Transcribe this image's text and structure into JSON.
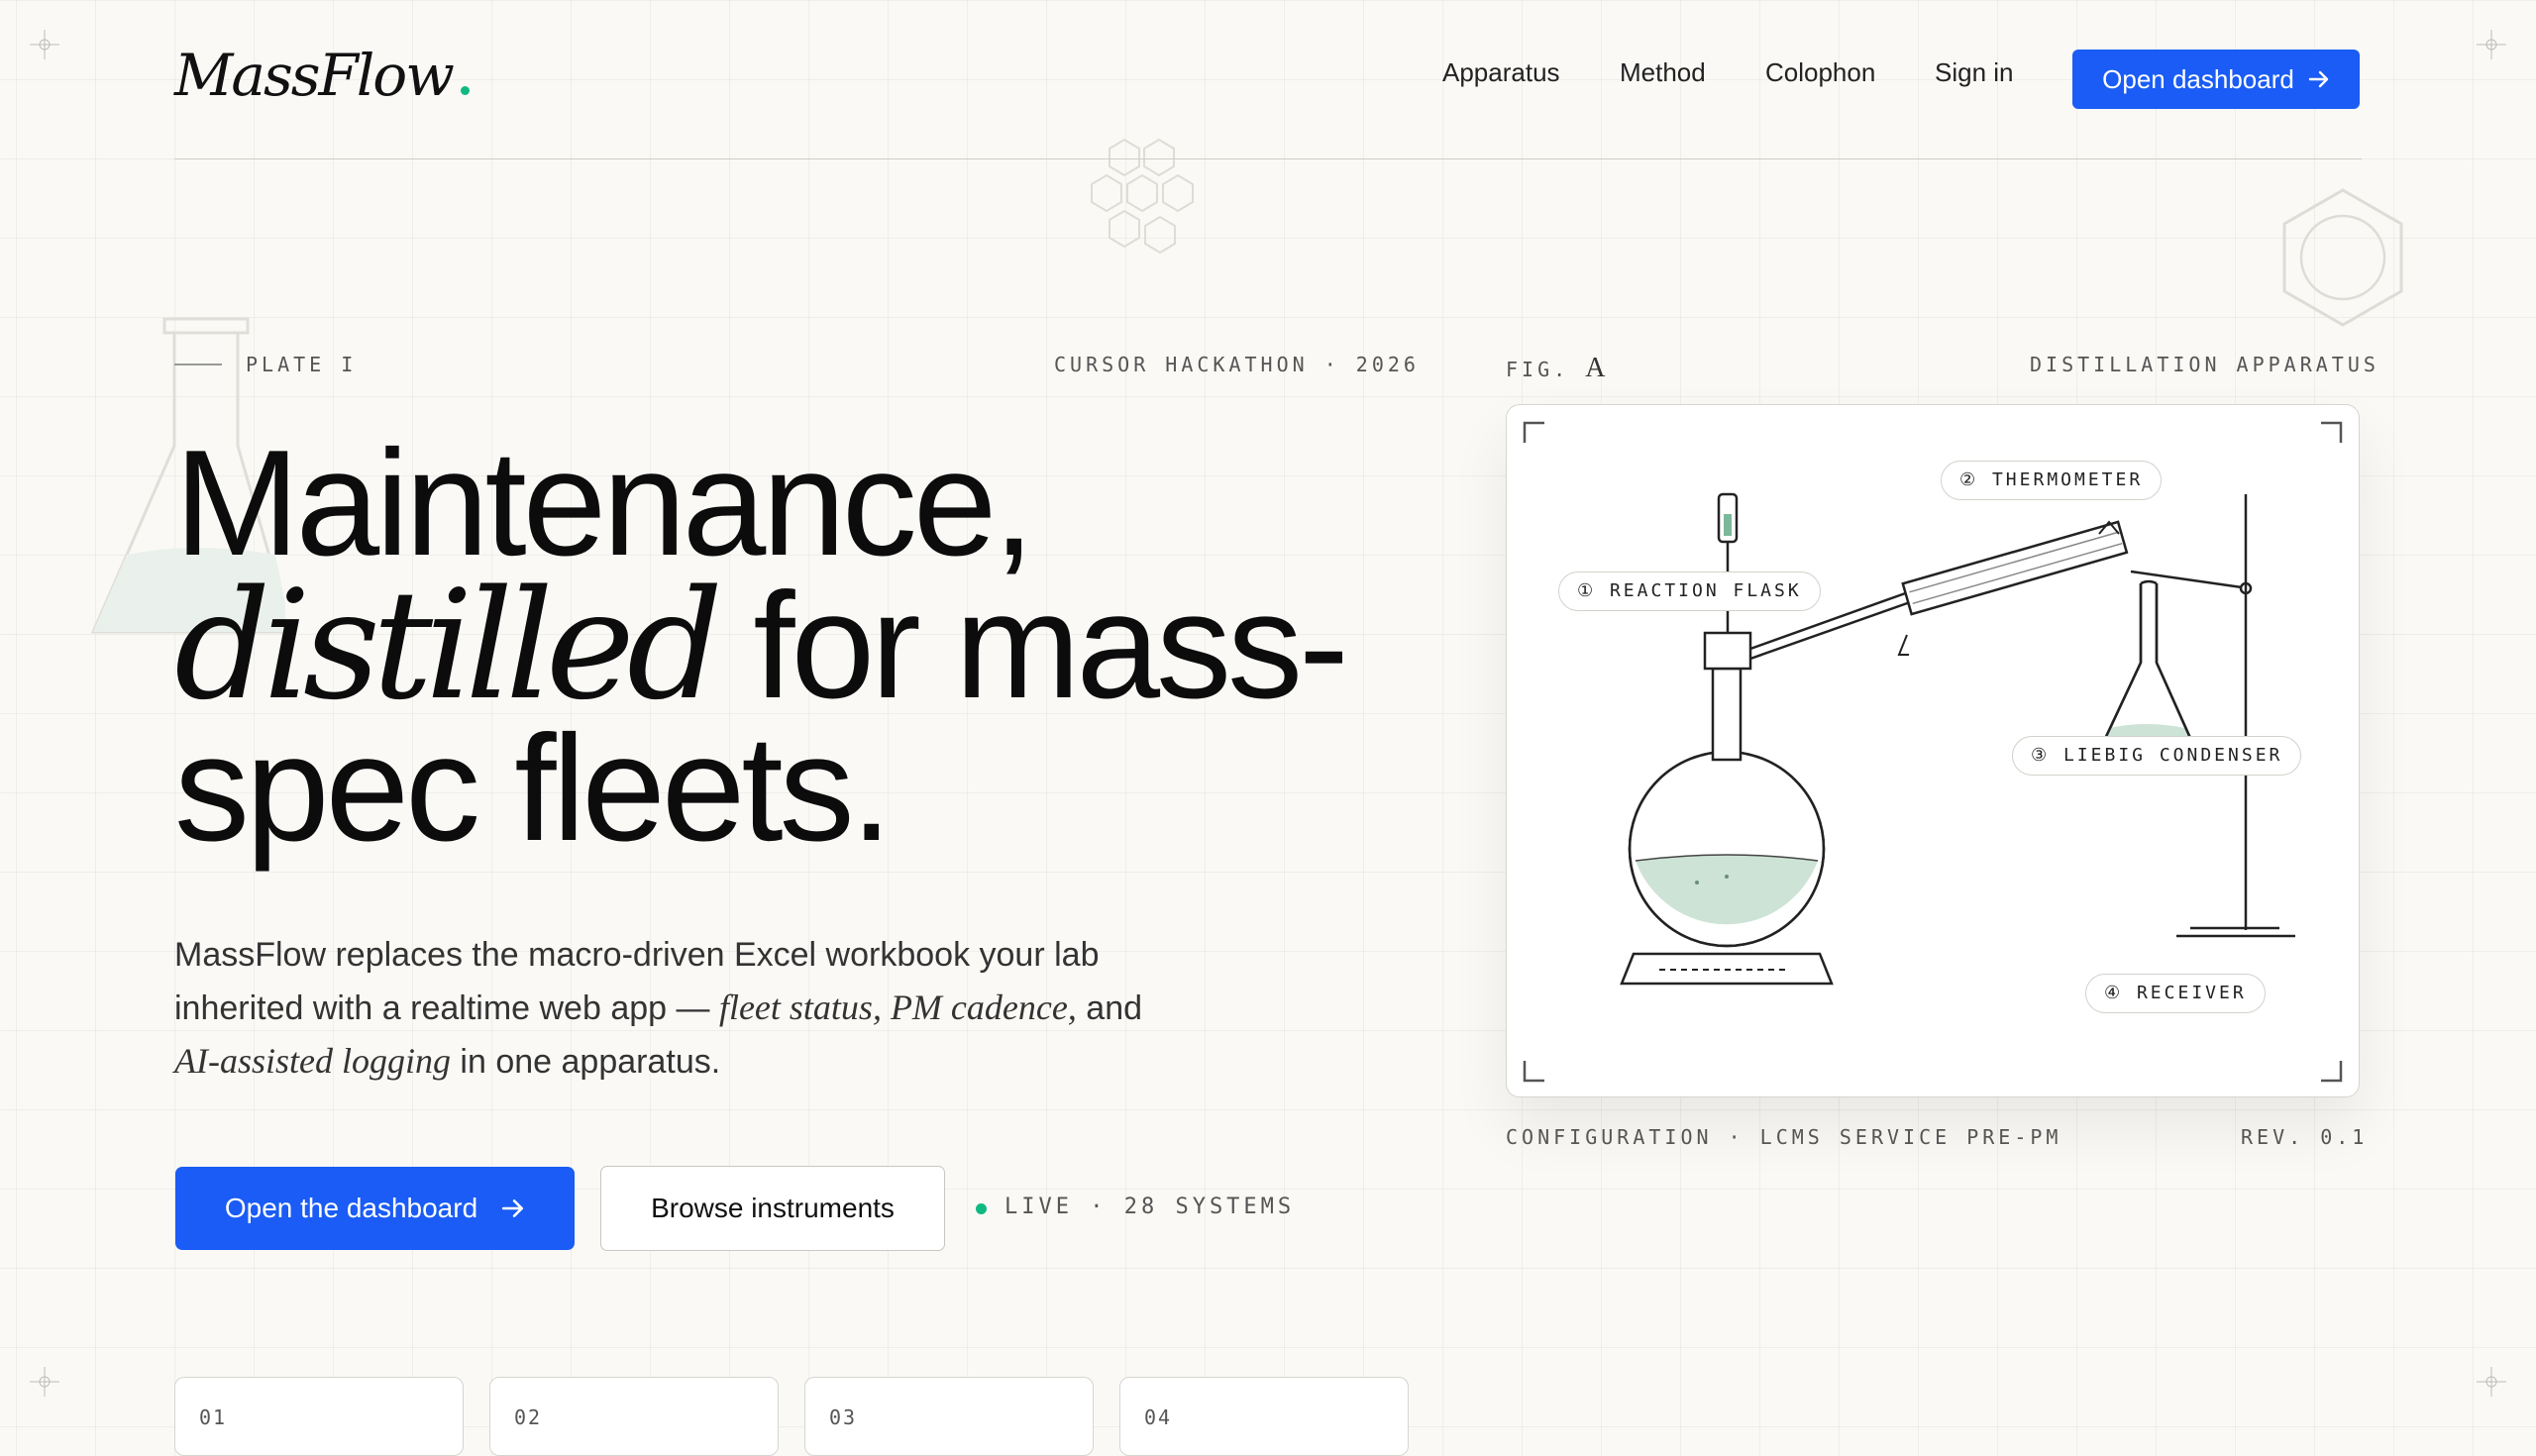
{
  "brand": {
    "name": "MassFlow",
    "accent": "#10b981",
    "primary": "#1a5cf5"
  },
  "nav": {
    "items": [
      "Apparatus",
      "Method",
      "Colophon",
      "Sign in"
    ],
    "cta": "Open dashboard"
  },
  "hero": {
    "plate": "PLATE I",
    "event": "CURSOR HACKATHON · 2026",
    "headline_1": "Maintenance,",
    "headline_em": "distilled",
    "headline_2": "for mass-",
    "headline_3": "spec fleets.",
    "lead_1": "MassFlow replaces the macro-driven Excel workbook your lab inherited with a realtime web app — ",
    "lead_em1": "fleet status, PM cadence,",
    "lead_2": " and ",
    "lead_em2": "AI-assisted logging",
    "lead_3": " in one apparatus.",
    "cta_primary": "Open the dashboard",
    "cta_secondary": "Browse instruments",
    "live_status": "LIVE · 28 SYSTEMS"
  },
  "figure": {
    "label": "FIG.",
    "letter": "A",
    "title": "DISTILLATION APPARATUS",
    "callouts": {
      "flask": "① REACTION FLASK",
      "thermometer": "② THERMOMETER",
      "condenser": "③ LIEBIG CONDENSER",
      "receiver": "④ RECEIVER"
    },
    "caption": "CONFIGURATION · LCMS SERVICE PRE-PM",
    "revision": "REV. 0.1"
  },
  "steps": [
    "01",
    "02",
    "03",
    "04"
  ]
}
